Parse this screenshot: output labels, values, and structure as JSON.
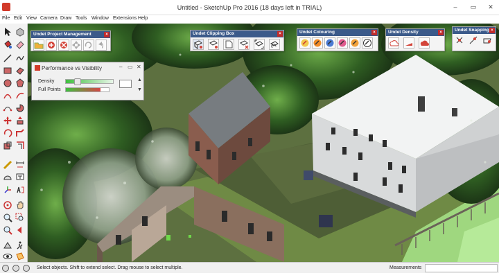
{
  "window": {
    "title": "Untitled - SketchUp Pro 2016 (18 days left in TRIAL)",
    "minimize": "–",
    "restore": "▭",
    "close": "✕"
  },
  "menu": [
    "File",
    "Edit",
    "View",
    "Camera",
    "Draw",
    "Tools",
    "Window",
    "Extensions",
    "Help"
  ],
  "toolbars": {
    "project_management": "Undet Project Management",
    "clipping_box": "Undet Clipping Box",
    "colouring": "Undet Colouring",
    "density": "Undet Density",
    "snapping": "Undet Snapping",
    "close_glyph": "×"
  },
  "performance": {
    "title": "Performance vs Visibility",
    "minimize": "–",
    "restore": "▭",
    "close": "✕",
    "density_label": "Density",
    "full_points_label": "Full Points",
    "density_level": 0.25,
    "full_points_level": 0.8,
    "spin_up": "▲",
    "spin_down": "▼"
  },
  "status": {
    "hint": "Select objects. Shift to extend select. Drag mouse to select multiple.",
    "measurements_label": "Measurements",
    "measurements_value": ""
  },
  "colors": {
    "toolbar_header": "#3b5a8a",
    "close_red": "#c02b2b",
    "sketchup_red": "#d23a2a"
  }
}
